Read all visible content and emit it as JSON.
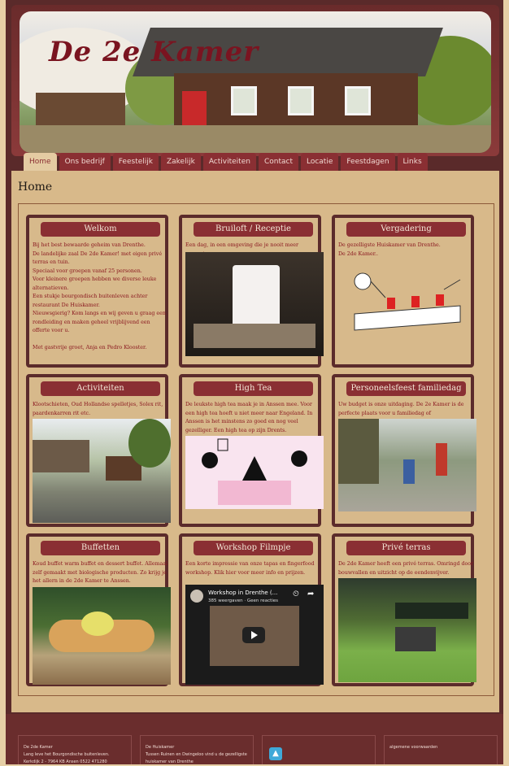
{
  "site": {
    "logo_text": "De 2e Kamer"
  },
  "nav": {
    "items": [
      "Home",
      "Ons bedrijf",
      "Feestelijk",
      "Zakelijk",
      "Activiteiten",
      "Contact",
      "Locatie",
      "Feestdagen",
      "Links"
    ],
    "active": "Home"
  },
  "page": {
    "title": "Home"
  },
  "cards": [
    {
      "title": "Welkom",
      "text": "Bij het best bewaarde geheim van Drenthe.\nDe landelijke zaal De 2de Kamer! met eigen privé terras en tuin.\nSpeciaal voor groepen vanaf 25 personen.\nVoor kleinere groepen hebben we diverse leuke alternatieven.\nEen stukje bourgondisch buitenleven achter restaurant De Huiskamer.\nNieuwsgierig? Kom langs en wij geven u graag een rondleiding en maken geheel vrijblijvend een offerte voor u.\n\nMet gastvrije groet, Anja en Pedro Klooster."
    },
    {
      "title": "Bruiloft / Receptie",
      "text": "Een dag, in een omgeving die je nooit meer vergeet."
    },
    {
      "title": "Vergadering",
      "text": "De gezelligste Huiskamer van Drenthe.\nDe 2de Kamer.."
    },
    {
      "title": "Activiteiten",
      "text": "Klootschieten, Oud Hollandse spelletjes, Solex rit, paardenkarren rit etc."
    },
    {
      "title": "High Tea",
      "text": "De leukste high tea maak je in Anssen mee. Voor een high tea hoeft u niet meer naar Engeland. In Anssen is het minstens zo goed en nog veel gezelliger. Een high tea op zijn Drents."
    },
    {
      "title": "Personeelsfeest familiedag",
      "text": "Uw budget is onze uitdaging. De 2e Kamer is de perfecte plaats voor u familiedag of personeelsfeest."
    },
    {
      "title": "Buffetten",
      "text": "Koud buffet warm buffet en dessert buffet. Allemaal zelf gemaakt met biologische producten. Zo krijg je het allern in de 2de Kamer te Anssen."
    },
    {
      "title": "Workshop Filmpje",
      "text": "Een korte impressie van onze tapas en fingerfood workshop. Klik hier voor meer info en prijzen."
    },
    {
      "title": "Privé terras",
      "text": "De 2de Kamer heeft een privé terras. Omringd door bouwvallen en uitzicht op de eendenvijver."
    }
  ],
  "video": {
    "title": "Workshop in Drenthe (...",
    "meta": "385 weergaven · Geen reacties"
  },
  "footer": {
    "box1": [
      "De 2de Kamer",
      "Lang leve het Bourgondische buitenleven.",
      "Kerkdijk 2 - 7964 KB Ansen 0522 471280"
    ],
    "box2": [
      "De Huiskamer",
      "Tussen Ruinen en Dwingeloo vind u de gezelligste",
      "huiskamer van Drenthe"
    ],
    "box4": "algemene voorwaarden"
  }
}
